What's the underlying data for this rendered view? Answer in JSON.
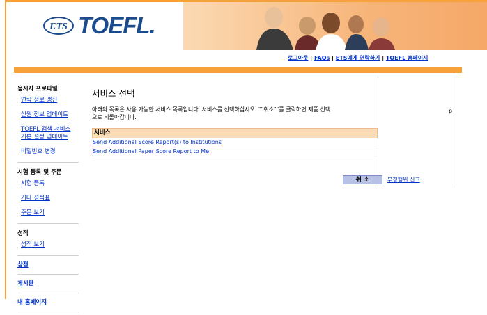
{
  "brand": {
    "ets": "ETS",
    "name": "TOEFL."
  },
  "top_links": [
    {
      "label": "로그아웃"
    },
    {
      "label": "FAQs"
    },
    {
      "label": "ETS에게 연락하기"
    },
    {
      "label": "TOEFL 홈페이지"
    }
  ],
  "top_links_separator": " | ",
  "sidebar": {
    "section1": {
      "heading": "응시자 프로파일",
      "items": [
        "연락 정보 갱신",
        "신원 정보 업데이트",
        "TOEFL 검색 서비스 기본 설정 업데이트",
        "비밀번호 변경"
      ]
    },
    "section2": {
      "heading": "시험 등록 및 주문",
      "items": [
        "시험 등록",
        "기타 성적표",
        "주문 보기"
      ]
    },
    "section3": {
      "heading": "성적",
      "items": [
        "성적 보기"
      ]
    },
    "bold_links": [
      "상점",
      "게시판",
      "내 홈페이지"
    ]
  },
  "main": {
    "title": "서비스 선택",
    "description_line1": "아래의 목록은 사용 가능한 서비스 목록입니다. 서비스를 선택하십시오. \"\"취소\"\"를 클릭하면 제품 선택",
    "description_line2": "으로 되돌아갑니다.",
    "description_overflow": "p",
    "services_header": "서비스",
    "services": [
      "Send Additional Score Report(s) to Institutions",
      "Send Additional Paper Score Report to Me"
    ],
    "cancel_label": "취 소",
    "report_fraud_label": "부정행위 신고"
  },
  "colors": {
    "accent_orange": "#f7a13a",
    "link_blue": "#0033cc",
    "brand_blue": "#1a4b8c",
    "services_header_bg": "#fcdcb6"
  }
}
